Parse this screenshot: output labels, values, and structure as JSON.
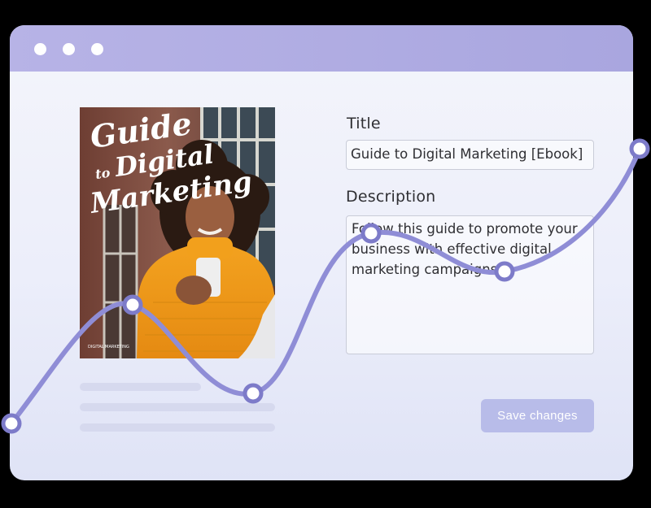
{
  "window": {
    "titlebar_dots": [
      "window-dot",
      "window-dot",
      "window-dot"
    ]
  },
  "ebook_cover": {
    "title_line1": "Guide",
    "title_line2": "to",
    "title_line3": "Digital",
    "title_line4": "Marketing",
    "small_print": "DIGITAL MARKETING"
  },
  "form": {
    "title_label": "Title",
    "title_value": "Guide to Digital Marketing [Ebook]",
    "description_label": "Description",
    "description_value": "Follow this guide to promote your business with effective digital marketing campaigns.",
    "save_label": "Save changes"
  },
  "colors": {
    "accent": "#8f8dd6",
    "titlebar": "#b2afe3",
    "button": "#b8bce9"
  }
}
